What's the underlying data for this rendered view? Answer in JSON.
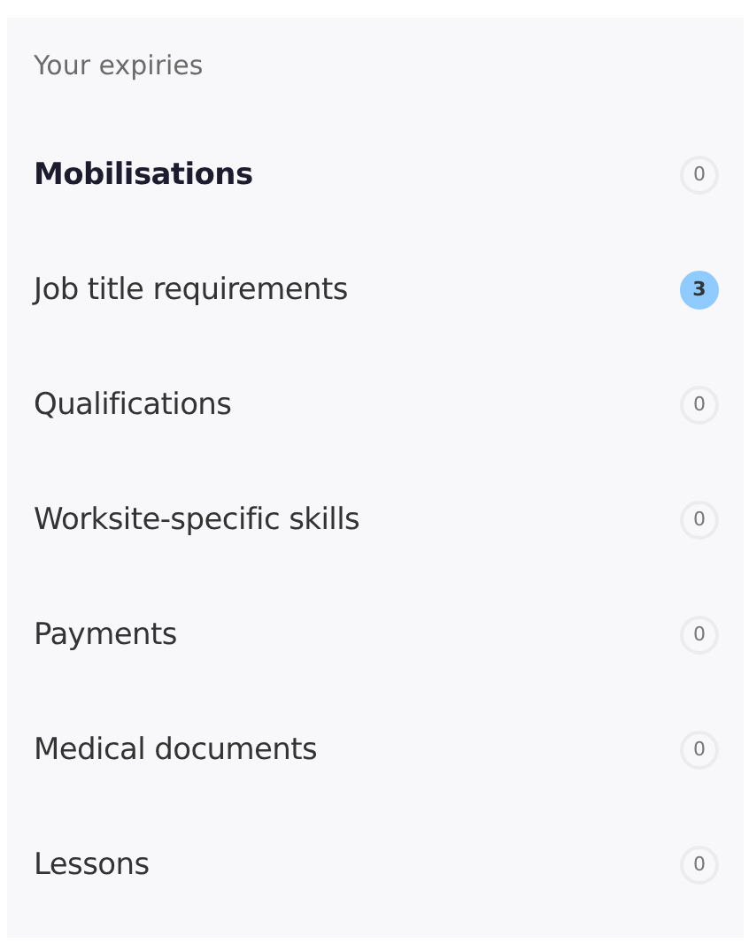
{
  "title": "Your expiries",
  "items": [
    {
      "label": "Mobilisations",
      "count": "0",
      "selected": true,
      "highlighted": false
    },
    {
      "label": "Job title requirements",
      "count": "3",
      "selected": false,
      "highlighted": true
    },
    {
      "label": "Qualifications",
      "count": "0",
      "selected": false,
      "highlighted": false
    },
    {
      "label": "Worksite-specific skills",
      "count": "0",
      "selected": false,
      "highlighted": false
    },
    {
      "label": "Payments",
      "count": "0",
      "selected": false,
      "highlighted": false
    },
    {
      "label": "Medical documents",
      "count": "0",
      "selected": false,
      "highlighted": false
    },
    {
      "label": "Lessons",
      "count": "0",
      "selected": false,
      "highlighted": false
    }
  ]
}
